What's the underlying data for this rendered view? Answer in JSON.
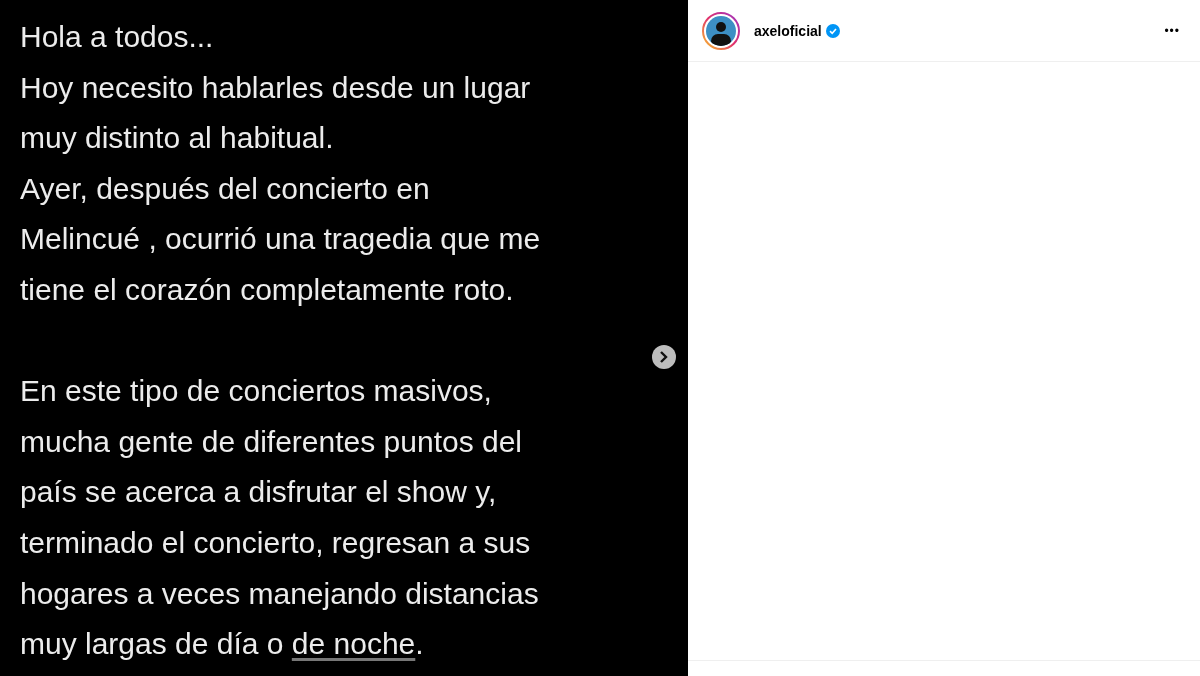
{
  "post_image": {
    "paragraphs": [
      {
        "lines": [
          {
            "text": "Hola a todos..."
          },
          {
            "text": "Hoy necesito hablarles desde un lugar"
          },
          {
            "text": "muy distinto al habitual."
          },
          {
            "text": "Ayer, después del concierto en"
          },
          {
            "text": "Melincué , ocurrió una tragedia que me"
          },
          {
            "text": "tiene el corazón completamente roto."
          }
        ]
      },
      {
        "lines": [
          {
            "text": "En este tipo de conciertos masivos,"
          },
          {
            "text": "mucha gente de diferentes puntos del"
          },
          {
            "text": "país se acerca a disfrutar el show y,"
          },
          {
            "text": "terminado el concierto, regresan a sus"
          },
          {
            "text": "hogares a veces manejando distancias"
          },
          {
            "text": "muy largas de día o ",
            "underlined": "de noche",
            "tail": "."
          }
        ]
      }
    ]
  },
  "header": {
    "username": "axeloficial",
    "verified": true,
    "more": "•••"
  }
}
